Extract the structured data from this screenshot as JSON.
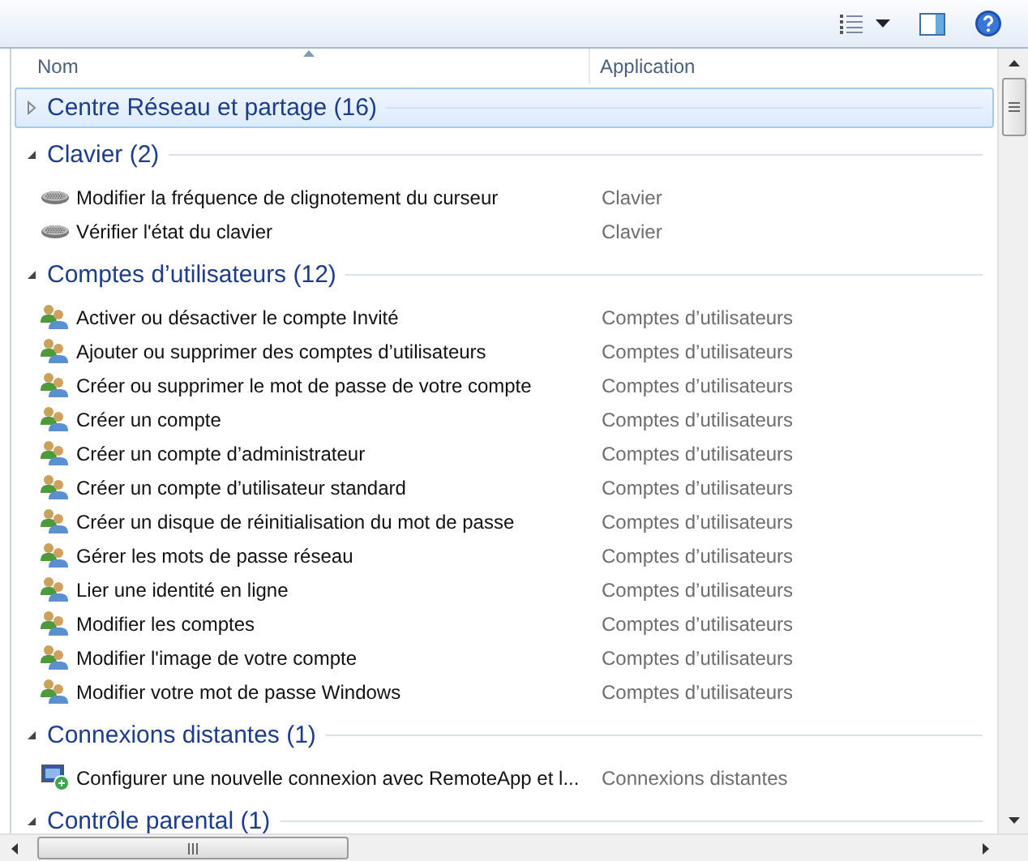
{
  "columns": [
    {
      "label": "Nom",
      "sorted": true
    },
    {
      "label": "Application",
      "sorted": false
    }
  ],
  "groups": [
    {
      "title": "Centre Réseau et partage (16)",
      "expanded": false,
      "selected": true
    },
    {
      "title": "Clavier (2)",
      "expanded": true,
      "selected": false,
      "items": [
        {
          "name": "Modifier la fréquence de clignotement du curseur",
          "app": "Clavier",
          "kind": "keyboard"
        },
        {
          "name": "Vérifier l'état du clavier",
          "app": "Clavier",
          "kind": "keyboard"
        }
      ]
    },
    {
      "title": "Comptes d’utilisateurs (12)",
      "expanded": true,
      "selected": false,
      "items": [
        {
          "name": "Activer ou désactiver le compte Invité",
          "app": "Comptes d’utilisateurs",
          "kind": "users"
        },
        {
          "name": "Ajouter ou supprimer des comptes d’utilisateurs",
          "app": "Comptes d’utilisateurs",
          "kind": "users"
        },
        {
          "name": "Créer ou supprimer le mot de passe de votre compte",
          "app": "Comptes d’utilisateurs",
          "kind": "users"
        },
        {
          "name": "Créer un compte",
          "app": "Comptes d’utilisateurs",
          "kind": "users"
        },
        {
          "name": "Créer un compte d’administrateur",
          "app": "Comptes d’utilisateurs",
          "kind": "users"
        },
        {
          "name": "Créer un compte d’utilisateur standard",
          "app": "Comptes d’utilisateurs",
          "kind": "users"
        },
        {
          "name": "Créer un disque de réinitialisation du mot de passe",
          "app": "Comptes d’utilisateurs",
          "kind": "users"
        },
        {
          "name": "Gérer les mots de passe réseau",
          "app": "Comptes d’utilisateurs",
          "kind": "users"
        },
        {
          "name": "Lier une identité en ligne",
          "app": "Comptes d’utilisateurs",
          "kind": "users"
        },
        {
          "name": "Modifier les comptes",
          "app": "Comptes d’utilisateurs",
          "kind": "users"
        },
        {
          "name": "Modifier l'image de votre compte",
          "app": "Comptes d’utilisateurs",
          "kind": "users"
        },
        {
          "name": "Modifier votre mot de passe Windows",
          "app": "Comptes d’utilisateurs",
          "kind": "users"
        }
      ]
    },
    {
      "title": "Connexions distantes (1)",
      "expanded": true,
      "selected": false,
      "items": [
        {
          "name": "Configurer une nouvelle connexion avec RemoteApp et l...",
          "app": "Connexions distantes",
          "kind": "remote"
        }
      ]
    },
    {
      "title": "Contrôle parental (1)",
      "expanded": true,
      "selected": false
    }
  ]
}
